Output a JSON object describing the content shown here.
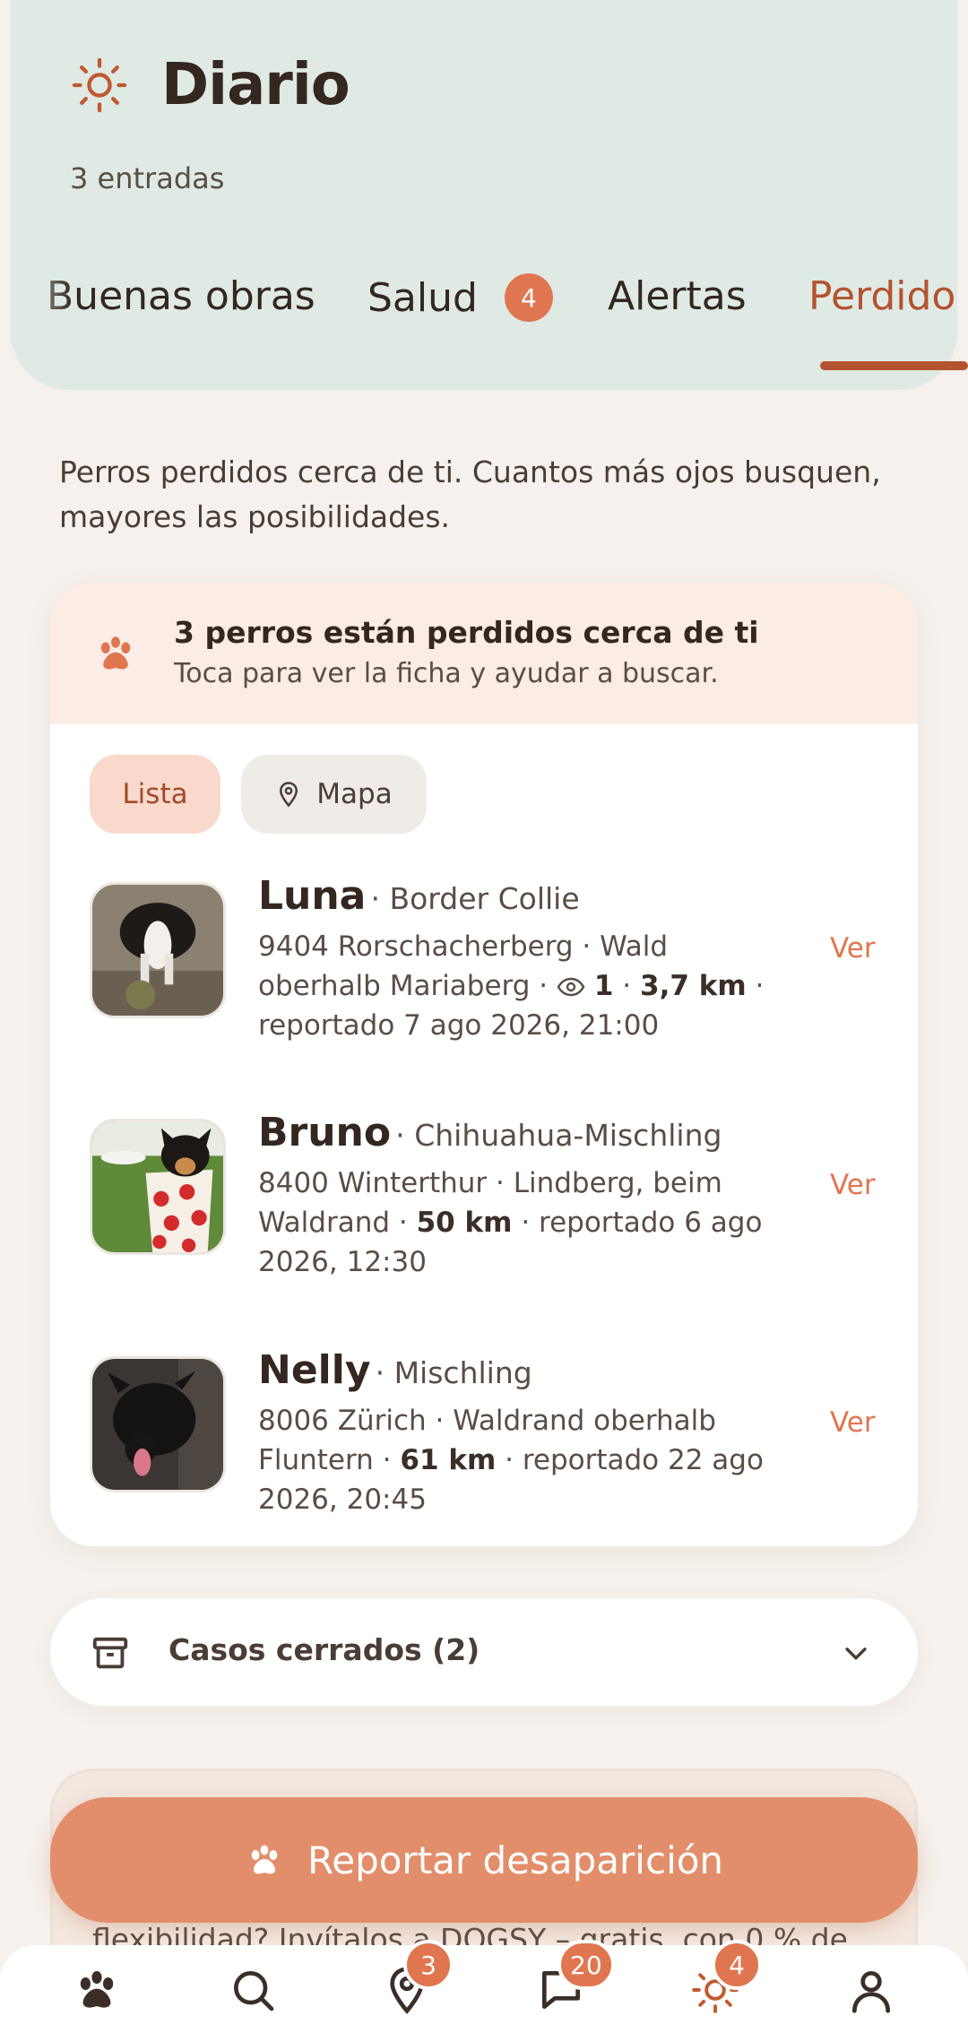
{
  "header": {
    "title": "Diario",
    "subtitle": "3 entradas",
    "tabs": [
      {
        "label": "Buenas obras"
      },
      {
        "label": "Salud",
        "badge": "4"
      },
      {
        "label": "Alertas"
      },
      {
        "label": "Perdido",
        "active": true
      }
    ]
  },
  "intro": "Perros perdidos cerca de ti. Cuantos más ojos busquen, mayores las posibilidades.",
  "banner": {
    "title": "3 perros están perdidos cerca de ti",
    "subtitle": "Toca para ver la ficha y ayudar a buscar."
  },
  "view_toggle": {
    "list_label": "Lista",
    "map_label": "Mapa",
    "selected": "Lista"
  },
  "dogs": [
    {
      "name": "Luna",
      "breed": "· Border Collie",
      "location": "9404 Rorschacherberg · Wald oberhalb Mariaberg ·",
      "views": "1",
      "distance": "3,7 km",
      "reported": "· reportado 7 ago 2026, 21:00",
      "action": "Ver"
    },
    {
      "name": "Bruno",
      "breed": "· Chihuahua-Mischling",
      "location": "8400 Winterthur · Lindberg, beim Waldrand ·",
      "distance": "50 km",
      "reported": "· reportado 6 ago 2026, 12:30",
      "action": "Ver"
    },
    {
      "name": "Nelly",
      "breed": "· Mischling",
      "location": "8006 Zürich · Waldrand oberhalb Fluntern ·",
      "distance": "61 km",
      "reported": "· reportado 22 ago 2026, 20:45",
      "action": "Ver"
    }
  ],
  "closed_cases": {
    "label": "Casos cerrados (2)"
  },
  "ghost_text": "flexibilidad? Invítalos a DOGSY – gratis, con 0 % de",
  "fab": {
    "label": "Reportar desaparición"
  },
  "bottom_nav": {
    "items": [
      {
        "icon": "paw-icon"
      },
      {
        "icon": "search-icon"
      },
      {
        "icon": "map-pin-icon",
        "badge": "3"
      },
      {
        "icon": "chat-icon",
        "badge": "20"
      },
      {
        "icon": "sun-icon",
        "badge": "4"
      },
      {
        "icon": "profile-icon"
      }
    ]
  },
  "colors": {
    "accent": "#e0764f",
    "header_bg": "#dfeae5",
    "active_tab": "#b4532f"
  }
}
